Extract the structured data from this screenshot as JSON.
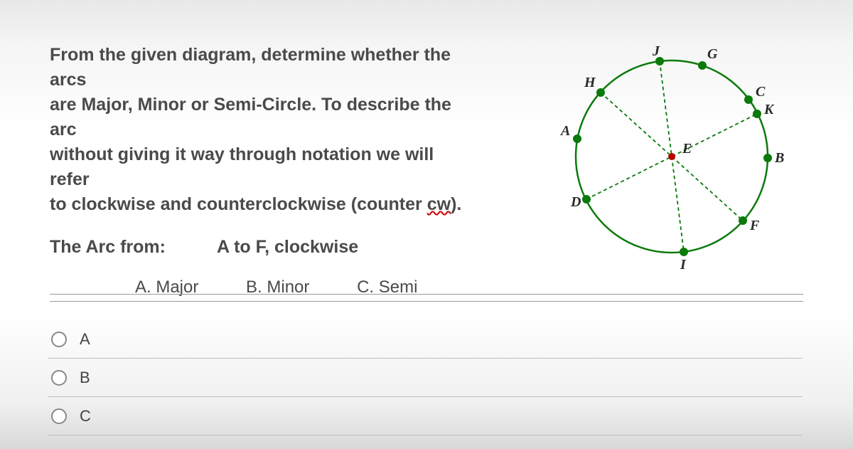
{
  "instruction": {
    "l1": "From the given diagram, determine whether the arcs",
    "l2": "are Major, Minor or Semi-Circle.  To describe the arc",
    "l3": "without giving it way through notation we will refer",
    "l4a": "to clockwise and counterclockwise (counter ",
    "l4b": "cw",
    "l4c": ")."
  },
  "arc": {
    "label": "The Arc from:",
    "value": "A to F, clockwise"
  },
  "choices": {
    "a": "A. Major",
    "b": "B. Minor",
    "c": "C. Semi"
  },
  "answers": {
    "a": "A",
    "b": "B",
    "c": "C"
  },
  "diagram": {
    "points": {
      "A": "A",
      "B": "B",
      "C": "C",
      "D": "D",
      "E": "E",
      "F": "F",
      "G": "G",
      "H": "H",
      "I": "I",
      "J": "J",
      "K": "K"
    }
  }
}
